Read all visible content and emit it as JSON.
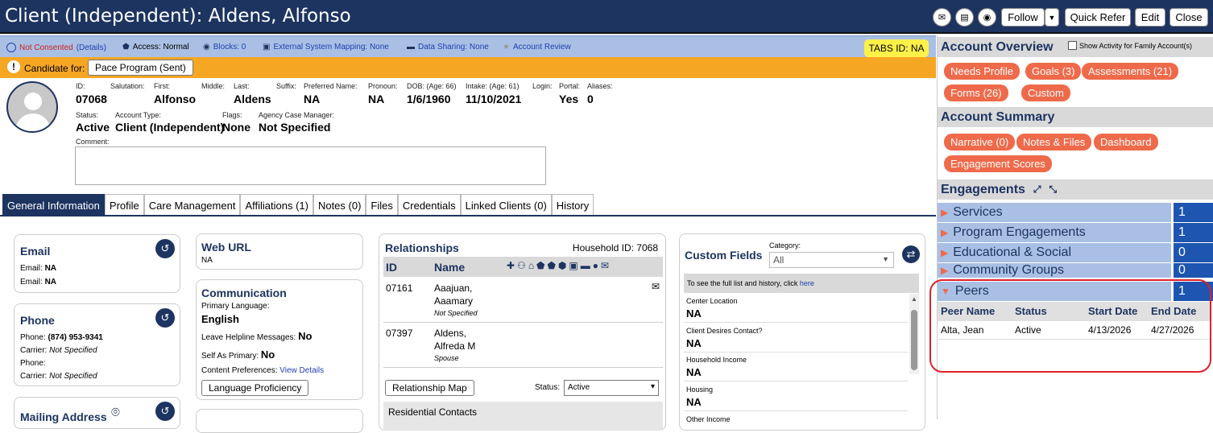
{
  "header": {
    "title": "Client (Independent): Aldens, Alfonso",
    "follow": "Follow",
    "quick_refer": "Quick Refer",
    "edit": "Edit",
    "close": "Close"
  },
  "infobar": {
    "not_consented": "Not Consented",
    "details": "(Details)",
    "access": "Access: Normal",
    "blocks": "Blocks: 0",
    "external": "External System Mapping: None",
    "sharing": "Data Sharing: None",
    "review": "Account Review",
    "tabs_id": "TABS ID: NA"
  },
  "candidate": {
    "label": "Candidate for:",
    "program": "Pace Program (Sent)"
  },
  "client": {
    "id_label": "ID:",
    "id": "07068",
    "salutation_label": "Salutation:",
    "first_label": "First:",
    "first": "Alfonso",
    "middle_label": "Middle:",
    "last_label": "Last:",
    "last": "Aldens",
    "suffix_label": "Suffix:",
    "preferred_label": "Preferred Name:",
    "preferred": "NA",
    "pronoun_label": "Pronoun:",
    "pronoun": "NA",
    "dob_label": "DOB: (Age: 66)",
    "dob": "1/6/1960",
    "intake_label": "Intake: (Age: 61)",
    "intake": "11/10/2021",
    "login_label": "Login:",
    "portal_label": "Portal:",
    "portal": "Yes",
    "aliases_label": "Aliases:",
    "aliases": "0",
    "status_label": "Status:",
    "status": "Active",
    "account_type_label": "Account Type:",
    "account_type": "Client (Independent)",
    "flags_label": "Flags:",
    "flags": "None",
    "acm_label": "Agency Case Manager:",
    "acm": "Not Specified",
    "comment_label": "Comment:"
  },
  "tabs": [
    "General Information",
    "Profile",
    "Care Management",
    "Affiliations (1)",
    "Notes (0)",
    "Files",
    "Credentials",
    "Linked Clients (0)",
    "History"
  ],
  "email": {
    "title": "Email",
    "l1": "Email:",
    "v1": "NA",
    "l2": "Email:",
    "v2": "NA"
  },
  "phone": {
    "title": "Phone",
    "phone_label": "Phone:",
    "phone": "(874) 953-9341",
    "carrier_label": "Carrier:",
    "carrier": "Not Specified",
    "phone2_label": "Phone:",
    "carrier2_label": "Carrier:",
    "carrier2": "Not Specified"
  },
  "mailing": {
    "title": "Mailing Address"
  },
  "weburl": {
    "title": "Web URL",
    "value": "NA"
  },
  "communication": {
    "title": "Communication",
    "lang_label": "Primary Language:",
    "lang": "English",
    "helpline_label": "Leave Helpline Messages:",
    "helpline": "No",
    "self_label": "Self As Primary:",
    "self": "No",
    "content_label": "Content Preferences:",
    "content_link": "View Details",
    "proficiency": "Language Proficiency"
  },
  "relationships": {
    "title": "Relationships",
    "household": "Household ID: 7068",
    "col_id": "ID",
    "col_name": "Name",
    "rows": [
      {
        "id": "07161",
        "name1": "Aaajuan,",
        "name2": "Aaamary",
        "role": "Not Specified"
      },
      {
        "id": "07397",
        "name1": "Aldens,",
        "name2": "Alfreda M",
        "role": "Spouse"
      }
    ],
    "map_button": "Relationship Map",
    "status_label": "Status:",
    "status": "Active",
    "residential": "Residential Contacts"
  },
  "custom": {
    "title": "Custom Fields",
    "category_label": "Category:",
    "category": "All",
    "note": "To see the full list and history, click ",
    "here": "here",
    "fields": [
      {
        "label": "Center Location",
        "value": "NA"
      },
      {
        "label": "Client Desires Contact?",
        "value": "NA"
      },
      {
        "label": "Household Income",
        "value": "NA"
      },
      {
        "label": "Housing",
        "value": "NA"
      },
      {
        "label": "Other Income",
        "value": ""
      }
    ]
  },
  "right": {
    "overview": "Account Overview",
    "show_activity": "Show Activity for Family Account(s)",
    "overview_pills": [
      "Needs Profile",
      "Goals (3)",
      "Assessments (21)",
      "Forms (26)",
      "Custom"
    ],
    "summary": "Account Summary",
    "summary_pills": [
      "Narrative (0)",
      "Notes & Files",
      "Dashboard",
      "Engagement Scores"
    ],
    "engagements": "Engagements",
    "eng_rows": [
      {
        "label": "Services",
        "count": "1"
      },
      {
        "label": "Program Engagements",
        "count": "1"
      },
      {
        "label": "Educational & Social",
        "count": "0"
      },
      {
        "label": "Community Groups",
        "count": "0"
      },
      {
        "label": "Peers",
        "count": "1"
      }
    ],
    "peers": {
      "cols": [
        "Peer Name",
        "Status",
        "Start Date",
        "End Date"
      ],
      "row": [
        "Alta, Jean",
        "Active",
        "4/13/2026",
        "4/27/2026"
      ]
    }
  },
  "colors": {
    "header": "#1d3461",
    "accent": "#ee6a4a",
    "highlight": "#e0202a"
  }
}
